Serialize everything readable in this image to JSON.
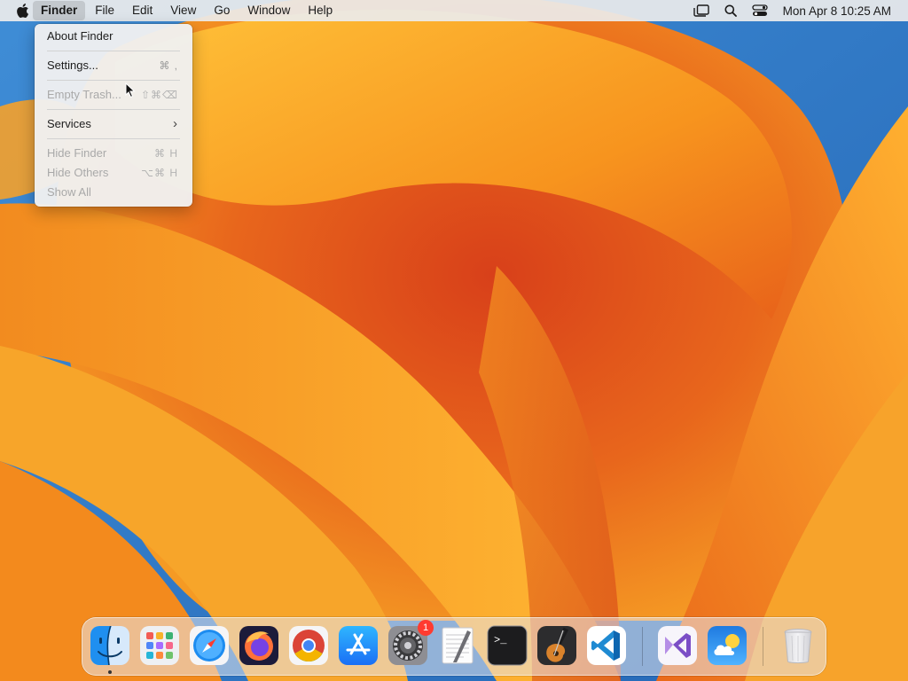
{
  "menubar": {
    "apple_icon": "apple-icon",
    "items": [
      {
        "label": "Finder",
        "active": true
      },
      {
        "label": "File"
      },
      {
        "label": "Edit"
      },
      {
        "label": "View"
      },
      {
        "label": "Go"
      },
      {
        "label": "Window"
      },
      {
        "label": "Help"
      }
    ],
    "status_icons": [
      "stage-manager-icon",
      "spotlight-search-icon",
      "control-center-icon"
    ],
    "clock": "Mon Apr 8  10:25 AM"
  },
  "finder_menu": {
    "items": [
      {
        "label": "About Finder",
        "shortcut": "",
        "enabled": true
      },
      {
        "label": "Settings...",
        "shortcut": "⌘ ,",
        "enabled": true
      },
      {
        "label": "Empty Trash...",
        "shortcut": "⇧⌘⌫",
        "enabled": false
      },
      {
        "label": "Services",
        "shortcut": "›",
        "enabled": true
      },
      {
        "label": "Hide Finder",
        "shortcut": "⌘ H",
        "enabled": false
      },
      {
        "label": "Hide Others",
        "shortcut": "⌥⌘ H",
        "enabled": false
      },
      {
        "label": "Show All",
        "shortcut": "",
        "enabled": false
      }
    ]
  },
  "dock": {
    "apps": [
      {
        "name": "Finder",
        "icon": "finder-icon",
        "running": true
      },
      {
        "name": "Launchpad",
        "icon": "launchpad-icon"
      },
      {
        "name": "Safari",
        "icon": "safari-icon"
      },
      {
        "name": "Firefox",
        "icon": "firefox-icon"
      },
      {
        "name": "Google Chrome",
        "icon": "chrome-icon"
      },
      {
        "name": "App Store",
        "icon": "app-store-icon"
      },
      {
        "name": "System Settings",
        "icon": "system-settings-icon",
        "badge": "1"
      },
      {
        "name": "TextEdit",
        "icon": "textedit-icon"
      },
      {
        "name": "Terminal",
        "icon": "terminal-icon"
      },
      {
        "name": "GarageBand",
        "icon": "garageband-icon"
      },
      {
        "name": "Visual Studio Code",
        "icon": "vscode-icon"
      },
      {
        "name": "Visual Studio",
        "icon": "visual-studio-icon"
      },
      {
        "name": "Weather",
        "icon": "weather-icon"
      },
      {
        "name": "Trash",
        "icon": "trash-icon"
      }
    ],
    "terminal_prompt": ">_"
  },
  "colors": {
    "accent_red": "#ff3b30",
    "wallpaper_orange": "#f08a1c",
    "wallpaper_blue": "#2c78c4"
  }
}
